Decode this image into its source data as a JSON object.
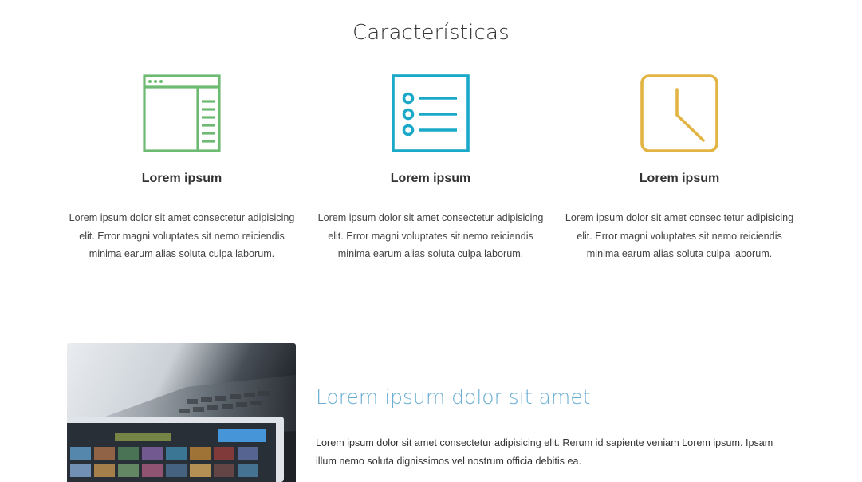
{
  "section": {
    "title": "Características"
  },
  "features": [
    {
      "icon": "browser-window-icon",
      "color": "#6dbb73",
      "title": "Lorem ipsum",
      "text": "Lorem ipsum dolor sit amet consectetur adipisicing elit. Error magni voluptates sit nemo reiciendis minima earum alias soluta culpa laborum."
    },
    {
      "icon": "list-icon",
      "color": "#1aa9c8",
      "title": "Lorem ipsum",
      "text": "Lorem ipsum dolor sit amet consectetur adipisicing elit. Error magni voluptates sit nemo reiciendis minima earum alias soluta culpa laborum."
    },
    {
      "icon": "clock-icon",
      "color": "#e2b444",
      "title": "Lorem ipsum",
      "text": "Lorem ipsum dolor sit amet consec tetur adipisicing elit. Error magni voluptates sit nemo reiciendis minima earum alias soluta culpa laborum."
    }
  ],
  "promo": {
    "image": "laptop-tablet-photo",
    "title": "Lorem ipsum dolor sit amet",
    "text": "Lorem ipsum dolor sit amet consectetur adipisicing elit. Rerum id sapiente veniam Lorem ipsum. Ipsam illum nemo soluta dignissimos vel nostrum officia debitis ea.",
    "title_color": "#6aaed4"
  }
}
